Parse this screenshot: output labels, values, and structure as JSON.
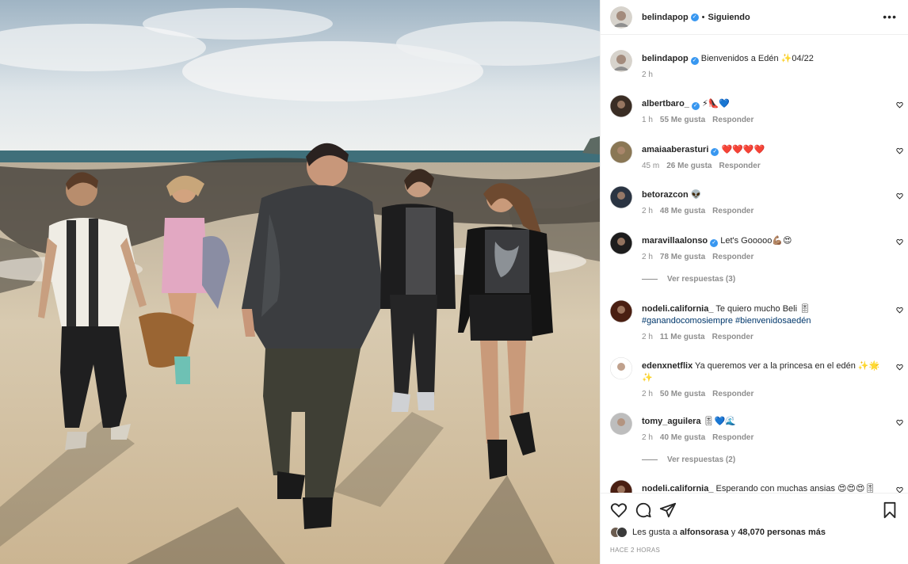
{
  "post": {
    "author": "belindapop",
    "follow_status": "Siguiendo",
    "more_icon": "more-options-icon"
  },
  "caption": {
    "user": "belindapop",
    "text": "Bienvenidos a Edén ✨04/22",
    "time": "2 h"
  },
  "comments": [
    {
      "user": "albertbaro_",
      "verified": true,
      "text": "⚡👠💙",
      "time": "1 h",
      "likes": "55 Me gusta",
      "reply": "Responder",
      "avatar_color": "#3a2d24"
    },
    {
      "user": "amaiaaberasturi",
      "verified": true,
      "text": "❤️❤️❤️❤️",
      "time": "45 m",
      "likes": "26 Me gusta",
      "reply": "Responder",
      "avatar_color": "#8a7755"
    },
    {
      "user": "betorazcon",
      "verified": false,
      "text": "👽",
      "time": "2 h",
      "likes": "48 Me gusta",
      "reply": "Responder",
      "avatar_color": "#2a3442"
    },
    {
      "user": "maravillaalonso",
      "verified": true,
      "text": "Let's Gooooo💪🏽😍",
      "time": "2 h",
      "likes": "78 Me gusta",
      "reply": "Responder",
      "avatar_color": "#1d1d1d",
      "replies": "Ver respuestas (3)"
    },
    {
      "user": "nodeli.california_",
      "verified": false,
      "text": "Te quiero mucho Beli 🎚",
      "hashtags": "#ganandocomosiempre #bienvenidosaedén",
      "time": "2 h",
      "likes": "11 Me gusta",
      "reply": "Responder",
      "avatar_color": "#4a1f12"
    },
    {
      "user": "edenxnetflix",
      "verified": false,
      "text": "Ya queremos ver a la princesa en el edén ✨🌟✨",
      "time": "2 h",
      "likes": "50 Me gusta",
      "reply": "Responder",
      "avatar_color": "#ffffff"
    },
    {
      "user": "tomy_aguilera",
      "verified": false,
      "text": "🎚💙🌊",
      "time": "2 h",
      "likes": "40 Me gusta",
      "reply": "Responder",
      "avatar_color": "#bdbdbd",
      "replies": "Ver respuestas (2)"
    },
    {
      "user": "nodeli.california_",
      "verified": false,
      "text": "Esperando con muchas ansias 😍😍😍🎚",
      "avatar_color": "#4a1f12"
    }
  ],
  "actions": {
    "like_icon": "heart-icon",
    "comment_icon": "comment-icon",
    "share_icon": "share-icon",
    "save_icon": "bookmark-icon"
  },
  "likes": {
    "prefix": "Les gusta a",
    "user": "alfonsorasa",
    "middle": "y",
    "count": "48,070 personas más"
  },
  "timestamp": "HACE 2 HORAS",
  "colors": {
    "verified": "#3897f0",
    "hashtag": "#00376b",
    "meta": "#8e8e8e"
  }
}
